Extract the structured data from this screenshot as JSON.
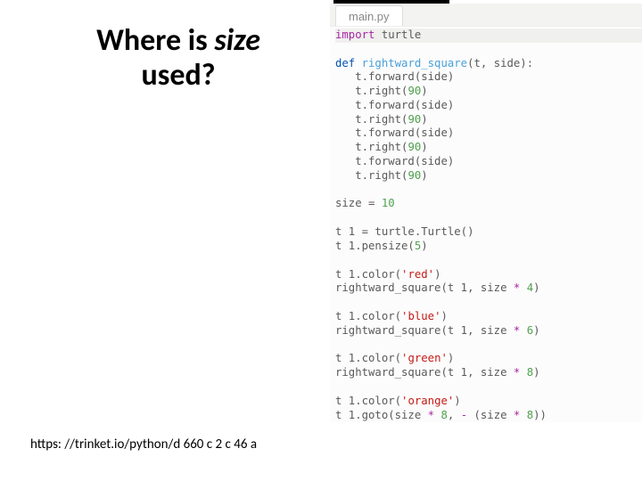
{
  "title_part1": "Where is ",
  "title_em": "size",
  "title_part2": " used?",
  "url": "https: //trinket.io/python/d 660 c 2 c 46 a",
  "tab_label": "main.py",
  "code": {
    "l01_import": "import",
    "l01_turtle": " turtle",
    "l03_def": "def",
    "l03_name": " rightward_square",
    "l03_rest": "(t, side):",
    "l04": "   t.forward(side)",
    "l05a": "   t.right(",
    "l05n": "90",
    "l05b": ")",
    "l06": "   t.forward(side)",
    "l07a": "   t.right(",
    "l07n": "90",
    "l07b": ")",
    "l08": "   t.forward(side)",
    "l09a": "   t.right(",
    "l09n": "90",
    "l09b": ")",
    "l10": "   t.forward(side)",
    "l11a": "   t.right(",
    "l11n": "90",
    "l11b": ")",
    "l13a": "size = ",
    "l13n": "10",
    "l15": "t 1 = turtle.Turtle()",
    "l16a": "t 1.pensize(",
    "l16n": "5",
    "l16b": ")",
    "l18a": "t 1.color(",
    "l18s": "'red'",
    "l18b": ")",
    "l19a": "rightward_square(t 1, size ",
    "l19op": "*",
    "l19sp": " ",
    "l19n": "4",
    "l19b": ")",
    "l21a": "t 1.color(",
    "l21s": "'blue'",
    "l21b": ")",
    "l22a": "rightward_square(t 1, size ",
    "l22op": "*",
    "l22sp": " ",
    "l22n": "6",
    "l22b": ")",
    "l24a": "t 1.color(",
    "l24s": "'green'",
    "l24b": ")",
    "l25a": "rightward_square(t 1, size ",
    "l25op": "*",
    "l25sp": " ",
    "l25n": "8",
    "l25b": ")",
    "l27a": "t 1.color(",
    "l27s": "'orange'",
    "l27b": ")",
    "l28a": "t 1.goto(size ",
    "l28op1": "*",
    "l28b": " ",
    "l28n1": "8",
    "l28c": ", ",
    "l28op2": "-",
    "l28d": " (size ",
    "l28op3": "*",
    "l28e": " ",
    "l28n2": "8",
    "l28f": "))"
  }
}
